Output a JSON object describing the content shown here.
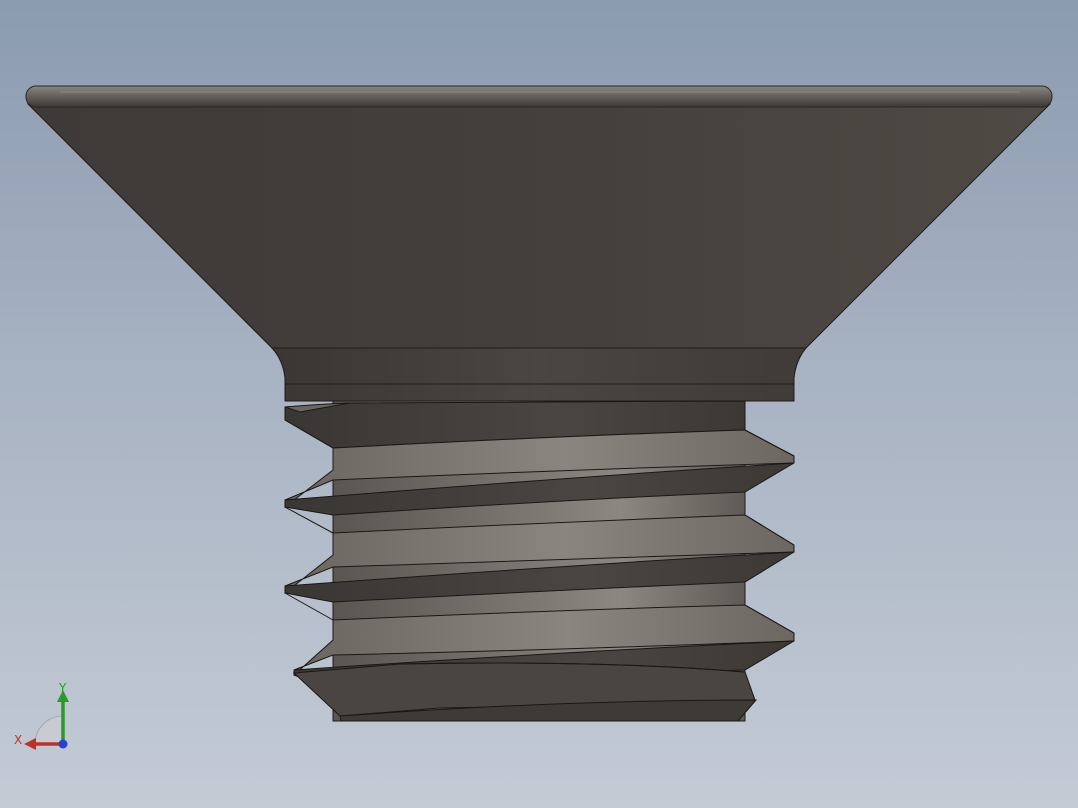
{
  "view": {
    "background_top": "#8b9bb0",
    "background_bottom": "#c4cbd5",
    "part_color": "#4a4540",
    "part_highlight": "#7a7570"
  },
  "triad": {
    "x_label": "X",
    "y_label": "Y",
    "x_color": "#c0302a",
    "y_color": "#2a9a2a",
    "z_color": "#2a40d0"
  }
}
